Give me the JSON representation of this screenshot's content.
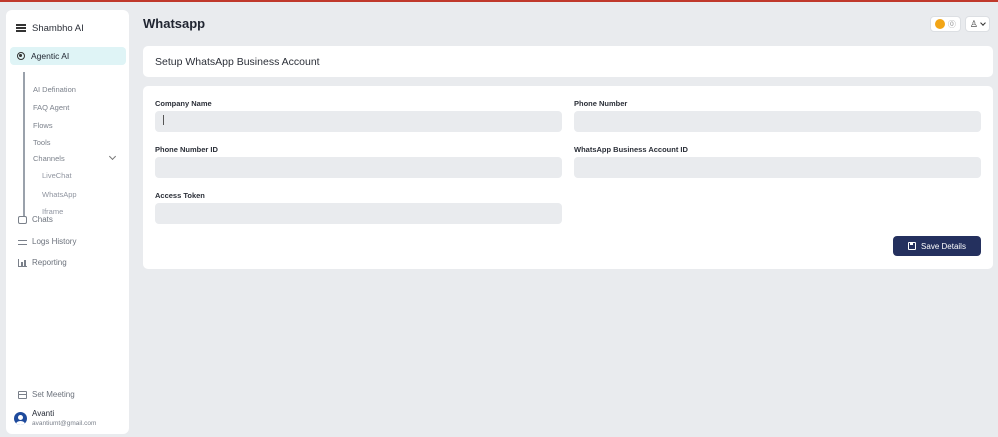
{
  "app": {
    "name": "Shambho AI"
  },
  "sidebar": {
    "active": {
      "label": "Agentic AI"
    },
    "sub_items": [
      {
        "label": "AI Defination"
      },
      {
        "label": "FAQ Agent"
      },
      {
        "label": "Flows"
      },
      {
        "label": "Tools"
      },
      {
        "label": "Channels"
      }
    ],
    "channels": [
      {
        "label": "LiveChat"
      },
      {
        "label": "WhatsApp"
      },
      {
        "label": "Iframe"
      }
    ],
    "items": [
      {
        "label": "Chats",
        "icon": "chat-icon"
      },
      {
        "label": "Logs History",
        "icon": "logs-icon"
      },
      {
        "label": "Reporting",
        "icon": "reporting-icon"
      }
    ],
    "set_meeting": "Set Meeting",
    "user": {
      "name": "Avanti",
      "email": "avantiumt@gmail.com"
    }
  },
  "header": {
    "title": "Whatsapp"
  },
  "setup": {
    "title": "Setup WhatsApp Business Account"
  },
  "form": {
    "company_name": {
      "label": "Company Name",
      "value": ""
    },
    "phone_number": {
      "label": "Phone Number",
      "value": ""
    },
    "phone_number_id": {
      "label": "Phone Number ID",
      "value": ""
    },
    "waba_id": {
      "label": "WhatsApp Business Account ID",
      "value": ""
    },
    "access_token": {
      "label": "Access Token",
      "value": ""
    },
    "save_label": "Save Details"
  },
  "colors": {
    "accent": "#24305e",
    "active_bg": "#dff4f6",
    "coin": "#f2a516",
    "top_border": "#c0392b"
  }
}
